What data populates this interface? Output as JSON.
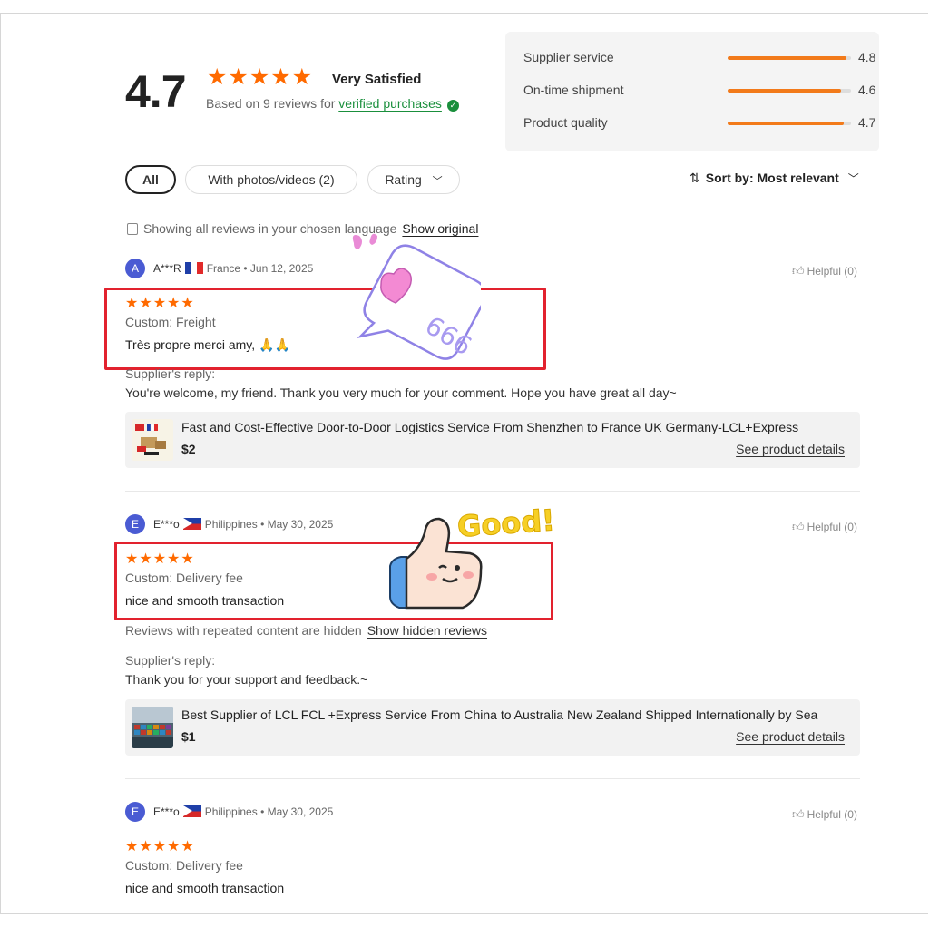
{
  "summary": {
    "score": "4.7",
    "stars": "★★★★★",
    "satisfaction": "Very Satisfied",
    "based_prefix": "Based on 9 reviews for",
    "verified_link": "verified purchases",
    "metrics": [
      {
        "label": "Supplier service",
        "value": "4.8",
        "level": 0.96
      },
      {
        "label": "On-time shipment",
        "value": "4.6",
        "level": 0.92
      },
      {
        "label": "Product quality",
        "value": "4.7",
        "level": 0.94
      }
    ]
  },
  "filters": {
    "all": "All",
    "photos": "With photos/videos (2)",
    "rating": "Rating",
    "sort": "Sort by: Most relevant"
  },
  "language": {
    "note": "Showing all reviews in your chosen language",
    "link": "Show original"
  },
  "reviews": [
    {
      "initial": "A",
      "name": "A***R",
      "country": "France",
      "date": "• Jun 12, 2025",
      "helpful": "Helpful (0)",
      "stars": "★★★★★",
      "custom": "Custom:  Freight",
      "text": "Très propre merci amy, 🙏🙏",
      "reply_heading": "Supplier's reply:",
      "reply": "You're welcome, my friend. Thank you very much for your comment. Hope you have great all day~",
      "product": {
        "title": "Fast and Cost-Effective Door-to-Door Logistics Service From Shenzhen to France UK Germany-LCL+Express",
        "price": "$2",
        "details": "See product details"
      }
    },
    {
      "initial": "E",
      "name": "E***o",
      "country": "Philippines",
      "date": "• May 30, 2025",
      "helpful": "Helpful (0)",
      "stars": "★★★★★",
      "custom": "Custom:  Delivery fee",
      "text": "nice and smooth transaction",
      "hidden_note": "Reviews with repeated content are hidden",
      "hidden_link": "Show hidden reviews",
      "reply_heading": "Supplier's reply:",
      "reply": "Thank you for your support and feedback.~",
      "product": {
        "title": "Best Supplier of LCL FCL +Express Service From China to Australia New Zealand Shipped Internationally by Sea",
        "price": "$1",
        "details": "See product details"
      }
    },
    {
      "initial": "E",
      "name": "E***o",
      "country": "Philippines",
      "date": "• May 30, 2025",
      "helpful": "Helpful (0)",
      "stars": "★★★★★",
      "custom": "Custom:  Delivery fee",
      "text": "nice and smooth transaction"
    }
  ],
  "stickers": {
    "bubble_text": "666",
    "good_text": "Good!"
  },
  "colors": {
    "star": "#ff6a00",
    "bar": "#f27a1a",
    "verified": "#1a8f3c",
    "highlight": "#e2222e",
    "avatar": "#4a5bd3"
  }
}
